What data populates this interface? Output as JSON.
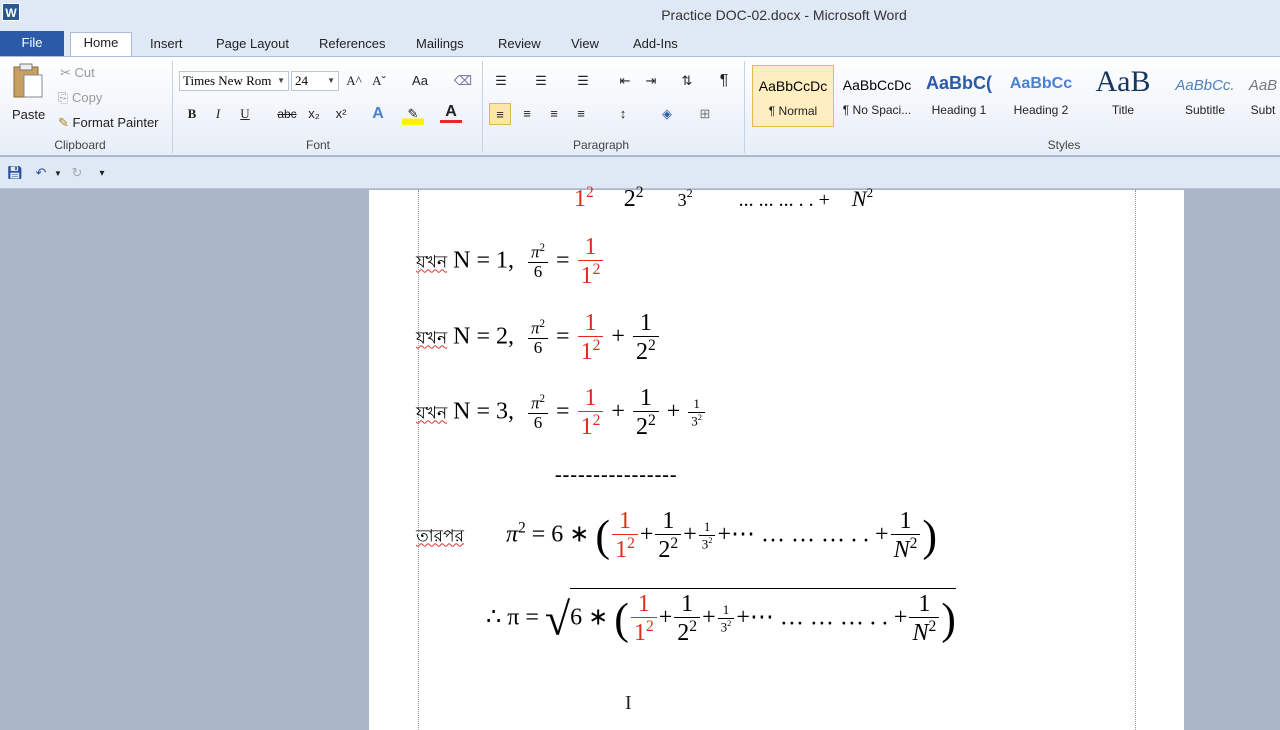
{
  "app": {
    "title": "Practice DOC-02.docx  -  Microsoft Word",
    "icon": "W"
  },
  "tabs": [
    "File",
    "Home",
    "Insert",
    "Page Layout",
    "References",
    "Mailings",
    "Review",
    "View",
    "Add-Ins"
  ],
  "clipboard": {
    "paste": "Paste",
    "cut": "Cut",
    "copy": "Copy",
    "format_painter": "Format Painter",
    "label": "Clipboard"
  },
  "font": {
    "name": "Times New Rom",
    "size": "24",
    "label": "Font",
    "bold": "B",
    "italic": "I",
    "underline": "U",
    "strike": "abc",
    "subscript": "x₂",
    "superscript": "x²",
    "font_color": "A",
    "grow": "A^",
    "shrink": "Aˇ",
    "change_case": "Aa"
  },
  "paragraph": {
    "label": "Paragraph"
  },
  "styles": {
    "label": "Styles",
    "items": [
      {
        "sample": "AaBbCcDc",
        "name": "¶ Normal"
      },
      {
        "sample": "AaBbCcDc",
        "name": "¶ No Spaci..."
      },
      {
        "sample": "AaBbC(",
        "name": "Heading 1"
      },
      {
        "sample": "AaBbCc",
        "name": "Heading 2"
      },
      {
        "sample": "AaB",
        "name": "Title"
      },
      {
        "sample": "AaBbCc.",
        "name": "Subtitle"
      },
      {
        "sample": "AaB",
        "name": "Subt"
      }
    ]
  },
  "document": {
    "top_partial": {
      "t1": "1",
      "t2": "2",
      "t3": "3",
      "dots": "... ... ... . . +",
      "N": "N"
    },
    "when": "যখন",
    "line1": {
      "lhs": "N = 1,",
      "pi_num": "π",
      "den": "6"
    },
    "line2": {
      "lhs": "N = 2,"
    },
    "line3": {
      "lhs": "N = 3,"
    },
    "dashes": "----------------",
    "then": "তারপর",
    "pi2": "π",
    "six_star": "= 6 ∗",
    "ellipsis": "⋯ … … … . . +",
    "therefore": "∴ π =",
    "six": "6 ∗",
    "one": "1",
    "N": "N"
  },
  "colors": {
    "file_tab": "#2a5aa8",
    "accent_red": "#e02b20"
  }
}
